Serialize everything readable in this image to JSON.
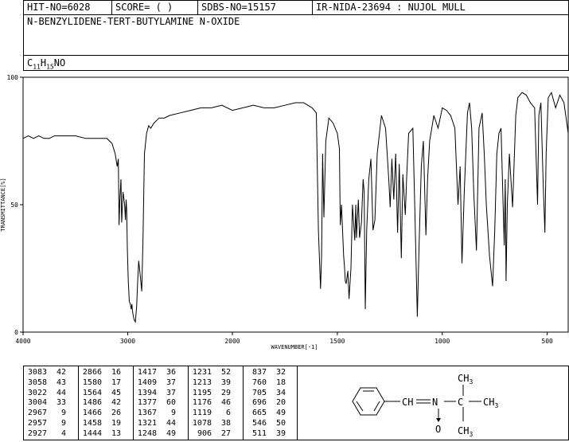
{
  "header": {
    "hit_no": "HIT-NO=6028",
    "score": "SCORE=  (   )",
    "sdbs_no": "SDBS-NO=15157",
    "ir_nida": "IR-NIDA-23694 : NUJOL MULL",
    "compound_name": "N-BENZYLIDENE-TERT-BUTYLAMINE N-OXIDE",
    "formula": {
      "c": "C",
      "c_sub": "11",
      "h": "H",
      "h_sub": "15",
      "rest": "NO"
    }
  },
  "chart_data": {
    "type": "line",
    "xlabel": "WAVENUMBER[-1]",
    "ylabel": "TRANSMITTANCE[%]",
    "xlim": [
      4000,
      400
    ],
    "ylim": [
      0,
      100
    ],
    "x_ticks": [
      4000,
      3000,
      2000,
      1500,
      1000,
      500
    ],
    "y_ticks": [
      0,
      50,
      100
    ],
    "series": [
      {
        "x": [
          4000,
          3950,
          3900,
          3850,
          3800,
          3750,
          3700,
          3650,
          3600,
          3500,
          3400,
          3300,
          3200,
          3150,
          3120,
          3100,
          3090,
          3083,
          3075,
          3065,
          3058,
          3045,
          3030,
          3022,
          3015,
          3010,
          3004,
          2995,
          2985,
          2975,
          2967,
          2960,
          2957,
          2950,
          2940,
          2927,
          2915,
          2905,
          2895,
          2880,
          2866,
          2855,
          2840,
          2820,
          2800,
          2780,
          2750,
          2700,
          2650,
          2600,
          2500,
          2400,
          2300,
          2200,
          2100,
          2000,
          1950,
          1900,
          1850,
          1800,
          1750,
          1700,
          1660,
          1640,
          1620,
          1600,
          1590,
          1580,
          1575,
          1570,
          1564,
          1555,
          1540,
          1520,
          1500,
          1490,
          1486,
          1480,
          1470,
          1466,
          1462,
          1458,
          1450,
          1444,
          1435,
          1428,
          1417,
          1412,
          1409,
          1400,
          1394,
          1385,
          1377,
          1372,
          1367,
          1360,
          1350,
          1340,
          1330,
          1321,
          1310,
          1290,
          1270,
          1255,
          1248,
          1240,
          1231,
          1222,
          1213,
          1205,
          1195,
          1188,
          1176,
          1170,
          1160,
          1140,
          1130,
          1119,
          1110,
          1100,
          1090,
          1078,
          1070,
          1060,
          1040,
          1020,
          1000,
          980,
          960,
          940,
          925,
          915,
          906,
          895,
          880,
          870,
          860,
          850,
          837,
          825,
          810,
          800,
          790,
          775,
          760,
          750,
          740,
          730,
          720,
          705,
          700,
          696,
          690,
          680,
          665,
          650,
          640,
          620,
          600,
          580,
          560,
          546,
          540,
          530,
          520,
          511,
          505,
          495,
          480,
          460,
          440,
          420,
          400
        ],
        "y": [
          76,
          77,
          76,
          77,
          76,
          76,
          77,
          77,
          77,
          77,
          76,
          76,
          76,
          74,
          70,
          65,
          68,
          42,
          52,
          60,
          43,
          55,
          50,
          44,
          52,
          48,
          33,
          20,
          12,
          11,
          9,
          11,
          9,
          7,
          5,
          4,
          10,
          20,
          28,
          22,
          16,
          35,
          70,
          78,
          81,
          80,
          82,
          84,
          84,
          85,
          86,
          87,
          88,
          88,
          89,
          87,
          88,
          89,
          88,
          88,
          89,
          90,
          90,
          89,
          88,
          86,
          40,
          17,
          30,
          70,
          45,
          75,
          84,
          82,
          78,
          72,
          42,
          50,
          30,
          26,
          20,
          19,
          24,
          13,
          25,
          50,
          36,
          50,
          37,
          52,
          37,
          43,
          60,
          55,
          9,
          40,
          60,
          68,
          40,
          44,
          70,
          85,
          80,
          60,
          49,
          68,
          52,
          70,
          39,
          66,
          29,
          62,
          46,
          60,
          78,
          80,
          45,
          6,
          35,
          65,
          75,
          38,
          60,
          75,
          85,
          80,
          88,
          87,
          85,
          80,
          50,
          65,
          27,
          55,
          86,
          90,
          80,
          55,
          32,
          80,
          86,
          70,
          50,
          30,
          18,
          40,
          70,
          78,
          80,
          34,
          60,
          20,
          50,
          70,
          49,
          85,
          92,
          94,
          93,
          90,
          88,
          50,
          85,
          90,
          60,
          39,
          70,
          92,
          94,
          88,
          93,
          90,
          78
        ],
        "color": "#000000"
      }
    ]
  },
  "peaks": [
    [
      [
        "3083",
        "42"
      ],
      [
        "3058",
        "43"
      ],
      [
        "3022",
        "44"
      ],
      [
        "3004",
        "33"
      ],
      [
        "2967",
        "9"
      ],
      [
        "2957",
        "9"
      ],
      [
        "2927",
        "4"
      ]
    ],
    [
      [
        "2866",
        "16"
      ],
      [
        "1580",
        "17"
      ],
      [
        "1564",
        "45"
      ],
      [
        "1486",
        "42"
      ],
      [
        "1466",
        "26"
      ],
      [
        "1458",
        "19"
      ],
      [
        "1444",
        "13"
      ]
    ],
    [
      [
        "1417",
        "36"
      ],
      [
        "1409",
        "37"
      ],
      [
        "1394",
        "37"
      ],
      [
        "1377",
        "60"
      ],
      [
        "1367",
        "9"
      ],
      [
        "1321",
        "44"
      ],
      [
        "1248",
        "49"
      ]
    ],
    [
      [
        "1231",
        "52"
      ],
      [
        "1213",
        "39"
      ],
      [
        "1195",
        "29"
      ],
      [
        "1176",
        "46"
      ],
      [
        "1119",
        "6"
      ],
      [
        "1078",
        "38"
      ],
      [
        "906",
        "27"
      ]
    ],
    [
      [
        "837",
        "32"
      ],
      [
        "760",
        "18"
      ],
      [
        "705",
        "34"
      ],
      [
        "696",
        "20"
      ],
      [
        "665",
        "49"
      ],
      [
        "546",
        "50"
      ],
      [
        "511",
        "39"
      ]
    ]
  ],
  "structure": {
    "ch3_top": "CH",
    "ch3_top_sub": "3",
    "ch3_right": "CH",
    "ch3_right_sub": "3",
    "ch3_bottom": "CH",
    "ch3_bottom_sub": "3",
    "c_label": "C",
    "n_label": "N",
    "ch_label": "CH",
    "o_label": "O"
  }
}
